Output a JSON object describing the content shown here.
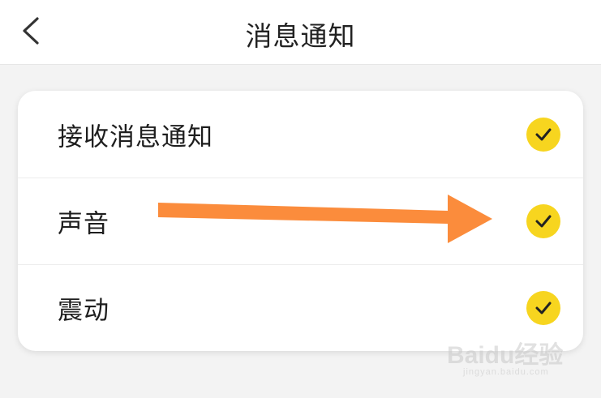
{
  "header": {
    "title": "消息通知",
    "back_icon": "chevron-left-icon"
  },
  "settings": [
    {
      "label": "接收消息通知",
      "checked": true
    },
    {
      "label": "声音",
      "checked": true
    },
    {
      "label": "震动",
      "checked": true
    }
  ],
  "colors": {
    "check_fill": "#f7d51f",
    "check_mark": "#222222",
    "arrow": "#fb8c3c",
    "background": "#f3f3f3"
  },
  "watermark": {
    "brand": "Baidu经验",
    "site": "jingyan.baidu.com"
  }
}
